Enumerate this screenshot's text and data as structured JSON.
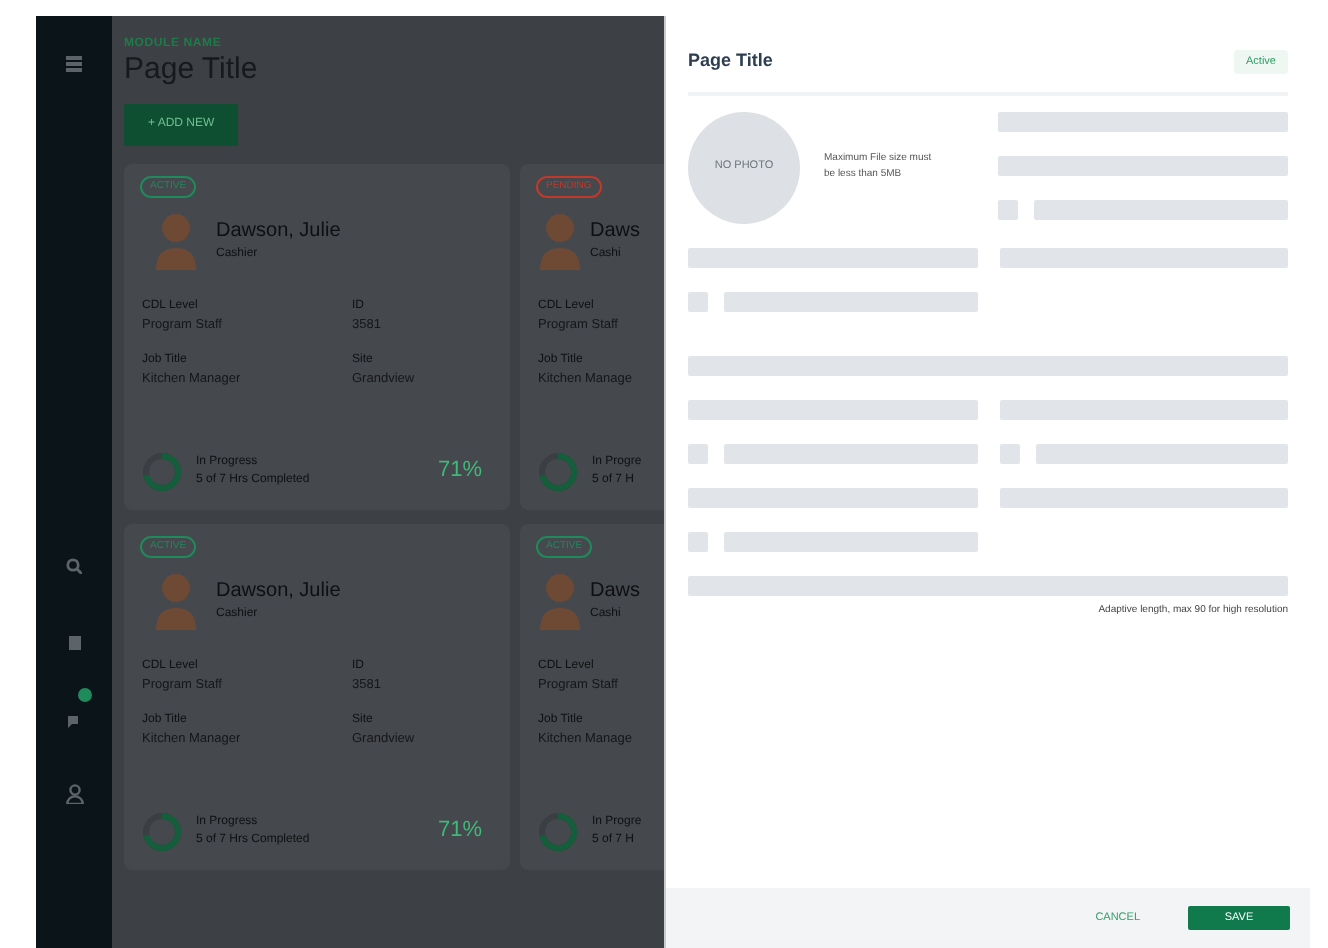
{
  "sidebar": {
    "notification": true
  },
  "header": {
    "module": "MODULE NAME",
    "title": "Page Title",
    "add_button": "+ ADD NEW"
  },
  "cards": [
    {
      "badge": {
        "text": "ACTIVE",
        "color": "#1f8a5a"
      },
      "name": "Dawson, Julie",
      "role": "Cashier",
      "fields": [
        {
          "label": "CDL Level",
          "value": "Program Staff"
        },
        {
          "label": "ID",
          "value": "3581"
        },
        {
          "label": "Job Title",
          "value": "Kitchen Manager"
        },
        {
          "label": "Site",
          "value": "Grandview"
        }
      ],
      "progress": {
        "status": "In Progress",
        "detail": "5 of 7 Hrs Completed",
        "level": 0.71,
        "percent": "71%"
      }
    },
    {
      "badge": {
        "text": "PENDING",
        "color": "#c0392b"
      },
      "name": "Daws",
      "role": "Cashi",
      "fields": [
        {
          "label": "CDL Level",
          "value": "Program Staff"
        },
        {
          "label": "Job Title",
          "value": "Kitchen Manage"
        }
      ],
      "progress": {
        "status": "In Progre",
        "detail": "5 of 7 H",
        "level": 0.71
      }
    },
    {
      "badge": {
        "text": "ACTIVE",
        "color": "#1f8a5a"
      },
      "name": "Dawson, Julie",
      "role": "Cashier",
      "fields": [
        {
          "label": "CDL Level",
          "value": "Program Staff"
        },
        {
          "label": "ID",
          "value": "3581"
        },
        {
          "label": "Job Title",
          "value": "Kitchen Manager"
        },
        {
          "label": "Site",
          "value": "Grandview"
        }
      ],
      "progress": {
        "status": "In Progress",
        "detail": "5 of 7 Hrs Completed",
        "level": 0.71,
        "percent": "71%"
      }
    },
    {
      "badge": {
        "text": "ACTIVE",
        "color": "#1f8a5a"
      },
      "name": "Daws",
      "role": "Cashi",
      "fields": [
        {
          "label": "CDL Level",
          "value": "Program Staff"
        },
        {
          "label": "Job Title",
          "value": "Kitchen Manage"
        }
      ],
      "progress": {
        "status": "In Progre",
        "detail": "5 of 7 H",
        "level": 0.71
      }
    }
  ],
  "panel": {
    "title": "Page Title",
    "status": "Active",
    "photo": "NO PHOTO",
    "photo_note": "Maximum File size must be less than 5MB",
    "caption": "Adaptive length, max 90 for high resolution",
    "cancel": "CANCEL",
    "save": "SAVE"
  }
}
